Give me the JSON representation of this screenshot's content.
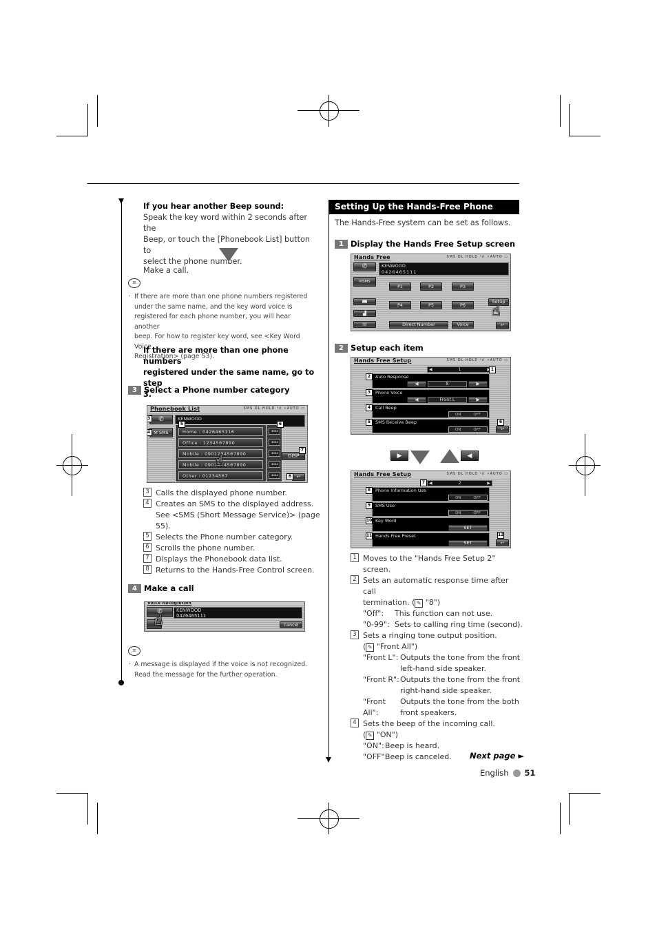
{
  "left": {
    "beep_heading": "If you hear another Beep sound:",
    "beep_text": [
      "Speak the key word within 2 seconds after the",
      "Beep, or touch the [Phonebook List] button to",
      "select the phone number."
    ],
    "make_call_text": "Make a call.",
    "note1_icon": "note-icon",
    "note1_lines": [
      "If there are more than one phone numbers registered",
      "under the same name, and the key word voice is",
      "registered for each phone number, you will hear another",
      "beep. For how to register key word, see <Key Word Voice",
      "Registration> (page 53)."
    ],
    "multi_heading": [
      "If there are more than one phone numbers",
      "registered under the same name, go to step",
      "3."
    ],
    "step3": {
      "num": "3",
      "title": "Select a Phone number category"
    },
    "phonebook_screen": {
      "title": "Phonebook List",
      "status": "SMS  DL  HOLD  ᵞıl  ⚡AUTO  ▭",
      "contact": "KENWOOD",
      "sms_label": "SMS",
      "entries": [
        "Home : 0426465116",
        "Office : 1234567890",
        "Mobile : 09012345678​90",
        "Mobile : 09012345678​90",
        "Other : 01234567"
      ],
      "entry_display": [
        "Home : 0426465116",
        "Office : 1234567890",
        "Mobile : 0901234567890",
        "Mobile : 0901234567890",
        "Other : 01234567"
      ],
      "scroll_label": "◂◂◂◂",
      "disp_label": "DISP",
      "callouts": [
        "3",
        "4",
        "5",
        "6",
        "7",
        "8"
      ]
    },
    "step3_desc": [
      {
        "num": "3",
        "text": [
          "Calls the displayed phone number."
        ]
      },
      {
        "num": "4",
        "text": [
          "Creates an SMS to the displayed address.",
          "See <SMS (Short Message Service)> (page",
          "55)."
        ]
      },
      {
        "num": "5",
        "text": [
          "Selects the Phone number category."
        ]
      },
      {
        "num": "6",
        "text": [
          "Scrolls the phone number."
        ]
      },
      {
        "num": "7",
        "text": [
          "Displays the Phonebook data list."
        ]
      },
      {
        "num": "8",
        "text": [
          "Returns to the Hands-Free Control screen."
        ]
      }
    ],
    "step4": {
      "num": "4",
      "title": "Make a call"
    },
    "voice_screen": {
      "title": "Voice Recognition",
      "contact": "KENWOOD",
      "number": "0426465111",
      "cancel_label": "Cancel"
    },
    "note2_lines": [
      "A message is displayed if the voice is not recognized.",
      "Read the message for the further operation."
    ]
  },
  "right": {
    "section_title": "Setting Up the Hands-Free Phone",
    "intro": "The Hands-Free system can be set as follows.",
    "step1": {
      "num": "1",
      "title": "Display the Hands Free Setup screen"
    },
    "handsfree_screen": {
      "title": "Hands Free",
      "status": "SMS  DL  HOLD  ᵞıl  ⚡AUTO  ▭",
      "contact": "KENWOOD",
      "number": "0426465111",
      "sms_label": "SMS",
      "presets": [
        "P1",
        "P2",
        "P3",
        "P4",
        "P5",
        "P6"
      ],
      "setup_label": "Setup",
      "direct_label": "Direct Number",
      "voice_label": "Voice"
    },
    "step2": {
      "num": "2",
      "title": "Setup each item"
    },
    "setup1_screen": {
      "title": "Hands Free Setup",
      "status": "SMS  DL  HOLD  ᵞıl  ⚡AUTO  ▭",
      "page": "1",
      "items": [
        {
          "callout": "2",
          "label": "Auto Response",
          "value": "8"
        },
        {
          "callout": "3",
          "label": "Phone Voice",
          "value": "Front L"
        },
        {
          "callout": "4",
          "label": "Call Beep",
          "on": "ON",
          "off": "OFF"
        },
        {
          "callout": "5",
          "label": "SMS Receive Beep",
          "on": "ON",
          "off": "OFF"
        }
      ],
      "callout_next": "1",
      "callout_back": "6"
    },
    "setup2_screen": {
      "title": "Hands Free Setup",
      "status": "SMS  DL  HOLD  ᵞıl  ⚡AUTO  ▭",
      "page": "2",
      "callout_prev": "7",
      "items": [
        {
          "callout": "8",
          "label": "Phone Information Use",
          "on": "ON",
          "off": "OFF"
        },
        {
          "callout": "9",
          "label": "SMS Use",
          "on": "ON",
          "off": "OFF"
        },
        {
          "callout": "10",
          "label": "Key Word",
          "btn": "SET"
        },
        {
          "callout": "11",
          "label": "Hands Free Preset",
          "btn": "SET"
        }
      ],
      "callout_back": "12"
    },
    "desc": {
      "d1": {
        "num": "1",
        "text": "Moves to the \"Hands Free Setup 2\" screen."
      },
      "d2": {
        "num": "2",
        "line1": "Sets an automatic response time after call",
        "line2a": "termination. (",
        "line2b": " \"8\")",
        "defs": [
          {
            "k": "\"Off\":",
            "v": "This function can not use."
          },
          {
            "k": "\"0-99\":",
            "v": "Sets to calling ring time (second)."
          }
        ]
      },
      "d3": {
        "num": "3",
        "line1": "Sets a ringing tone output position.",
        "line2a": "(",
        "line2b": " \"Front All\")",
        "defs": [
          {
            "k": "\"Front L\":",
            "v": [
              "Outputs the tone from the front",
              "left-hand side speaker."
            ]
          },
          {
            "k": "\"Front R\":",
            "v": [
              "Outputs the tone from the front",
              "right-hand side speaker."
            ]
          },
          {
            "k": "\"Front All\":",
            "v": [
              "Outputs the tone from the both",
              "front speakers."
            ]
          }
        ]
      },
      "d4": {
        "num": "4",
        "line1": "Sets the beep of the incoming call.",
        "line2a": "(",
        "line2b": " \"ON\")",
        "defs": [
          {
            "k": "\"ON\":",
            "v": "Beep is heard."
          },
          {
            "k": "\"OFF\":",
            "v": "Beep is canceled."
          }
        ]
      }
    },
    "next_page": "Next page ►",
    "footer_lang": "English",
    "footer_page": "51"
  }
}
